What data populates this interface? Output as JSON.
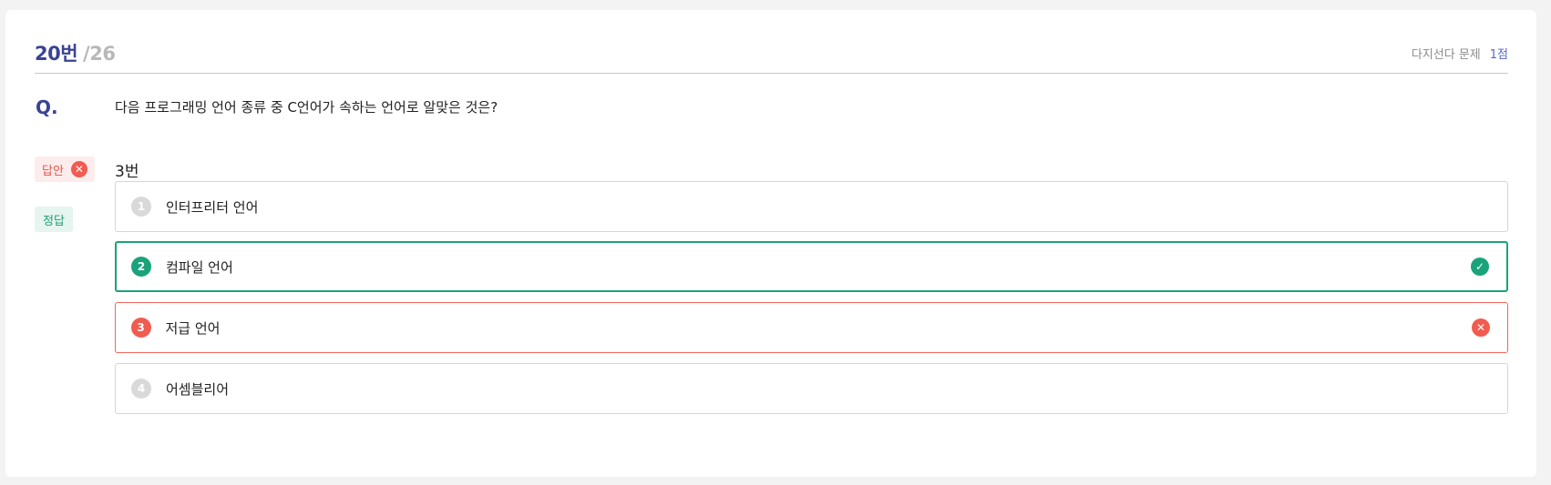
{
  "header": {
    "question_number": "20번",
    "question_total": "/26",
    "question_type": "다지선다 문제",
    "points": "1점"
  },
  "question": {
    "label": "Q.",
    "text": "다음 프로그래밍 언어 종류 중 C언어가 속하는 언어로 알맞은 것은?"
  },
  "user_answer": {
    "badge_label": "답안",
    "value": "3번"
  },
  "correct": {
    "badge_label": "정답"
  },
  "options": [
    {
      "number": "1",
      "text": "인터프리터 언어",
      "state": "none"
    },
    {
      "number": "2",
      "text": "컴파일 언어",
      "state": "correct"
    },
    {
      "number": "3",
      "text": "저급 언어",
      "state": "wrong"
    },
    {
      "number": "4",
      "text": "어셈블리어",
      "state": "none"
    }
  ],
  "colors": {
    "accent_navy": "#3b4394",
    "correct_green": "#1aa37a",
    "wrong_red": "#f25b50"
  },
  "icons": {
    "wrong": "x-circle-icon",
    "correct": "check-circle-icon"
  }
}
